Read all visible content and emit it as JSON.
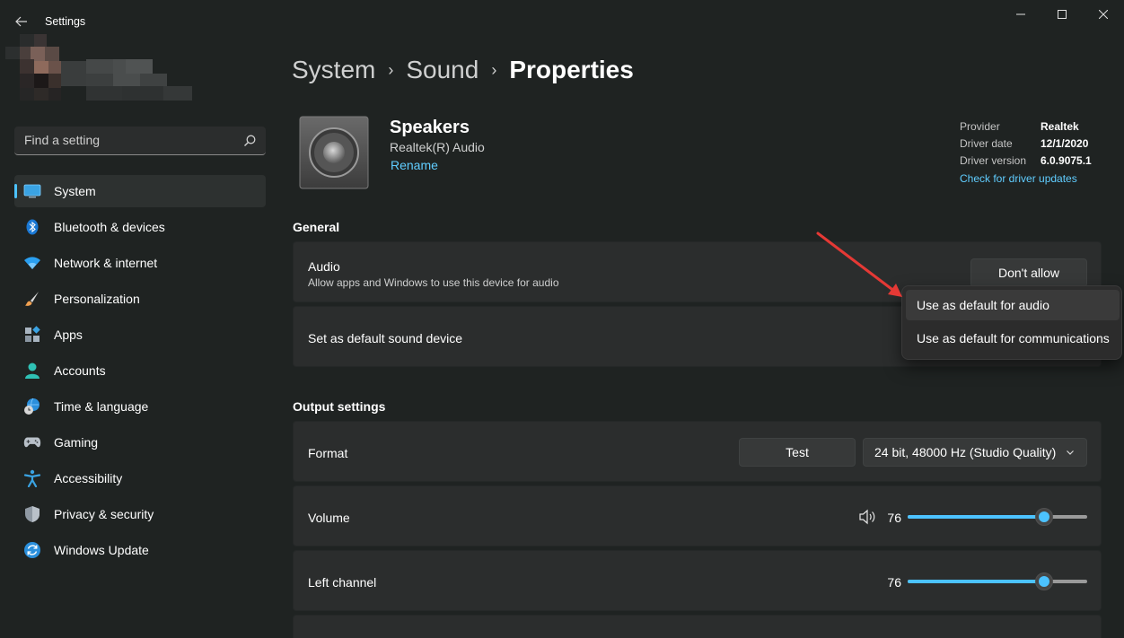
{
  "window": {
    "title": "Settings"
  },
  "search": {
    "placeholder": "Find a setting"
  },
  "nav": {
    "items": [
      {
        "label": "System",
        "icon": "monitor-icon",
        "active": true
      },
      {
        "label": "Bluetooth & devices",
        "icon": "bluetooth-icon"
      },
      {
        "label": "Network & internet",
        "icon": "wifi-icon"
      },
      {
        "label": "Personalization",
        "icon": "brush-icon"
      },
      {
        "label": "Apps",
        "icon": "apps-icon"
      },
      {
        "label": "Accounts",
        "icon": "person-icon"
      },
      {
        "label": "Time & language",
        "icon": "globe-clock-icon"
      },
      {
        "label": "Gaming",
        "icon": "gamepad-icon"
      },
      {
        "label": "Accessibility",
        "icon": "accessibility-icon"
      },
      {
        "label": "Privacy & security",
        "icon": "shield-icon"
      },
      {
        "label": "Windows Update",
        "icon": "update-icon"
      }
    ]
  },
  "breadcrumb": {
    "items": [
      "System",
      "Sound",
      "Properties"
    ],
    "separator": "›"
  },
  "device": {
    "name": "Speakers",
    "subtitle": "Realtek(R) Audio",
    "rename_label": "Rename"
  },
  "driver": {
    "provider_label": "Provider",
    "provider_value": "Realtek",
    "date_label": "Driver date",
    "date_value": "12/1/2020",
    "version_label": "Driver version",
    "version_value": "6.0.9075.1",
    "update_link": "Check for driver updates"
  },
  "general": {
    "title": "General",
    "audio": {
      "label": "Audio",
      "description": "Allow apps and Windows to use this device for audio",
      "button": "Don't allow"
    },
    "default_device": {
      "label": "Set as default sound device"
    }
  },
  "menu": {
    "items": [
      "Use as default for audio",
      "Use as default for communications"
    ]
  },
  "output": {
    "title": "Output settings",
    "format": {
      "label": "Format",
      "test_button": "Test",
      "selected": "24 bit, 48000 Hz (Studio Quality)"
    },
    "volume": {
      "label": "Volume",
      "value": "76",
      "level": 0.76
    },
    "left_channel": {
      "label": "Left channel",
      "value": "76",
      "level": 0.76
    }
  },
  "colors": {
    "accent": "#4cc2ff",
    "link": "#60cdff",
    "annotation_arrow": "#e53935"
  }
}
